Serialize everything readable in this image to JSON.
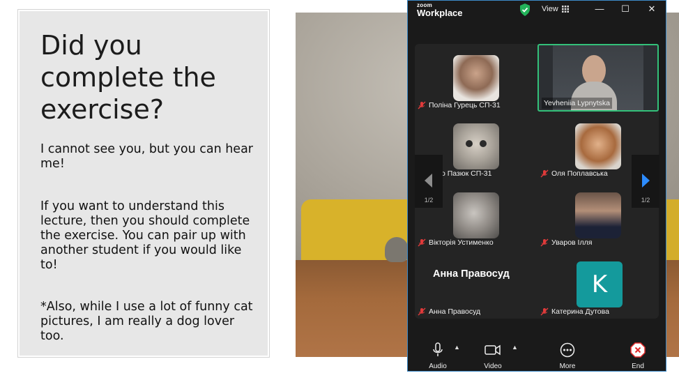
{
  "slide": {
    "title": "Did you complete the exercise?",
    "para1": "I cannot see you, but you can hear me!",
    "para2": "If you want to understand this lecture, then you should complete the exercise. You can pair up with another student if you would like to!",
    "para3": "*Also, while I use a lot of funny cat pictures, I am really a dog lover too."
  },
  "zoom": {
    "brand_small": "zoom",
    "brand_big": "Workplace",
    "view_label": "View",
    "window_controls": {
      "minimize": "—",
      "maximize": "☐",
      "close": "✕"
    },
    "page_indicator_left": "1/2",
    "page_indicator_right": "1/2",
    "active_speaker_color": "#33c17a",
    "accent_color": "#2d8cff",
    "participants": [
      {
        "name": "Поліна Гурець СП-31",
        "muted": true,
        "video": "photo"
      },
      {
        "name": "Yevheniia Lypnytska",
        "muted": false,
        "video": "camera",
        "active_speaker": true
      },
      {
        "name": "айло Пазюк СП-31",
        "muted": true,
        "video": "photo"
      },
      {
        "name": "Оля Поплавська",
        "muted": true,
        "video": "photo"
      },
      {
        "name": "Вікторія Устименко",
        "muted": true,
        "video": "photo"
      },
      {
        "name": "Уваров Ілля",
        "muted": true,
        "video": "photo"
      },
      {
        "name": "Анна Правосуд",
        "muted": true,
        "video": "off",
        "display_name": "Анна Правосуд"
      },
      {
        "name": "Катерина Дутова",
        "muted": true,
        "video": "initial",
        "initial": "K"
      }
    ],
    "toolbar": {
      "audio": "Audio",
      "video": "Video",
      "more": "More",
      "end": "End"
    }
  }
}
